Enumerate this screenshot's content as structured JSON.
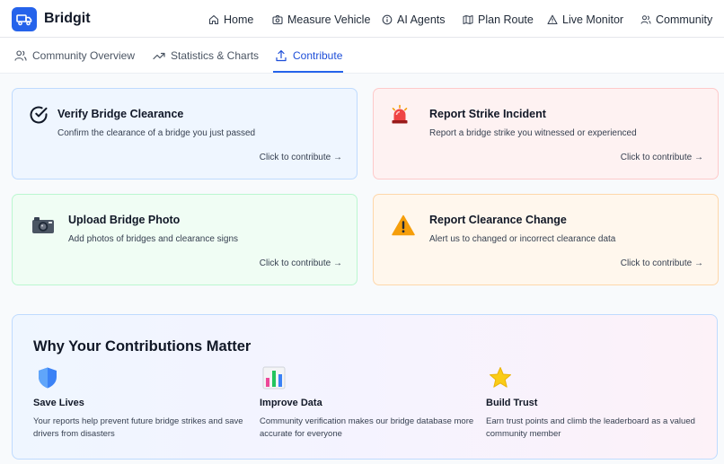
{
  "app": {
    "brand": "Bridgit"
  },
  "nav": [
    {
      "label": "Home",
      "icon": "home-icon"
    },
    {
      "label": "Measure Vehicle",
      "icon": "camera-icon"
    },
    {
      "label": "AI Agents",
      "icon": "info-icon"
    },
    {
      "label": "Plan Route",
      "icon": "map-icon"
    },
    {
      "label": "Live Monitor",
      "icon": "alert-triangle-icon"
    },
    {
      "label": "Community",
      "icon": "users-icon"
    }
  ],
  "tabs": [
    {
      "label": "Community Overview",
      "icon": "users-icon",
      "active": false
    },
    {
      "label": "Statistics & Charts",
      "icon": "trending-up-icon",
      "active": false
    },
    {
      "label": "Contribute",
      "icon": "upload-icon",
      "active": true
    }
  ],
  "cards": [
    {
      "title": "Verify Bridge Clearance",
      "desc": "Confirm the clearance of a bridge you just passed",
      "link": "Click to contribute →",
      "icon": "check-circle-icon",
      "bg": "#eff6ff",
      "border": "#bfdbfe"
    },
    {
      "title": "Report Strike Incident",
      "desc": "Report a bridge strike you witnessed or experienced",
      "link": "Click to contribute →",
      "icon": "siren-icon",
      "bg": "#fef2f2",
      "border": "#fecaca"
    },
    {
      "title": "Upload Bridge Photo",
      "desc": "Add photos of bridges and clearance signs",
      "link": "Click to contribute →",
      "icon": "camera-icon",
      "bg": "#f0fdf4",
      "border": "#bbf7d0"
    },
    {
      "title": "Report Clearance Change",
      "desc": "Alert us to changed or incorrect clearance data",
      "link": "Click to contribute →",
      "icon": "warning-icon",
      "bg": "#fff7ed",
      "border": "#fed7aa"
    }
  ],
  "why": {
    "title": "Why Your Contributions Matter",
    "items": [
      {
        "title": "Save Lives",
        "desc": "Your reports help prevent future bridge strikes and save drivers from disasters",
        "icon": "shield-icon"
      },
      {
        "title": "Improve Data",
        "desc": "Community verification makes our bridge database more accurate for everyone",
        "icon": "bar-chart-icon"
      },
      {
        "title": "Build Trust",
        "desc": "Earn trust points and climb the leaderboard as a valued community member",
        "icon": "star-icon"
      }
    ]
  },
  "colors": {
    "accent": "#2563eb",
    "text": "#111827"
  }
}
